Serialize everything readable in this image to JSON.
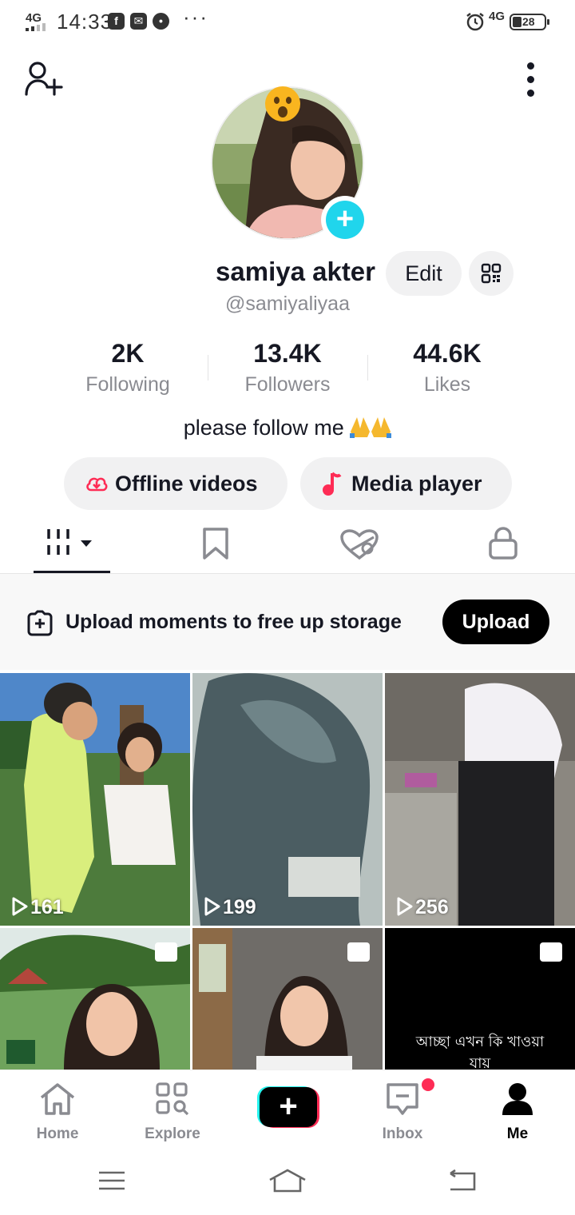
{
  "status_bar": {
    "network_left": "4G",
    "time": "14:33",
    "notif_icons": [
      "facebook-icon",
      "mail-icon",
      "chat-icon"
    ],
    "more": "···",
    "network_right": "4G",
    "battery": "28"
  },
  "profile": {
    "name": "samiya akter",
    "edit_label": "Edit",
    "handle": "@samiyaliyaa",
    "bio": "please follow me",
    "bio_emoji": "folded-hands-icon"
  },
  "stats": [
    {
      "value": "2K",
      "label": "Following"
    },
    {
      "value": "13.4K",
      "label": "Followers"
    },
    {
      "value": "44.6K",
      "label": "Likes"
    }
  ],
  "actions": {
    "offline": "Offline videos",
    "media": "Media player"
  },
  "tabs": [
    "videos-tab",
    "favorites-tab",
    "liked-tab",
    "private-tab"
  ],
  "upload_banner": {
    "text": "Upload moments to free up storage",
    "button": "Upload"
  },
  "grid": {
    "videos": [
      {
        "views": "161"
      },
      {
        "views": "199"
      },
      {
        "views": "256"
      }
    ],
    "bottom_caption": "আচ্ছা এখন কি খাওয়া",
    "bottom_caption2": "যায়"
  },
  "nav": {
    "home": "Home",
    "explore": "Explore",
    "inbox": "Inbox",
    "me": "Me"
  },
  "colors": {
    "accent_cyan": "#20d5ec",
    "accent_red": "#fe2c55",
    "text_primary": "#161823",
    "text_secondary": "#8a8b91"
  }
}
